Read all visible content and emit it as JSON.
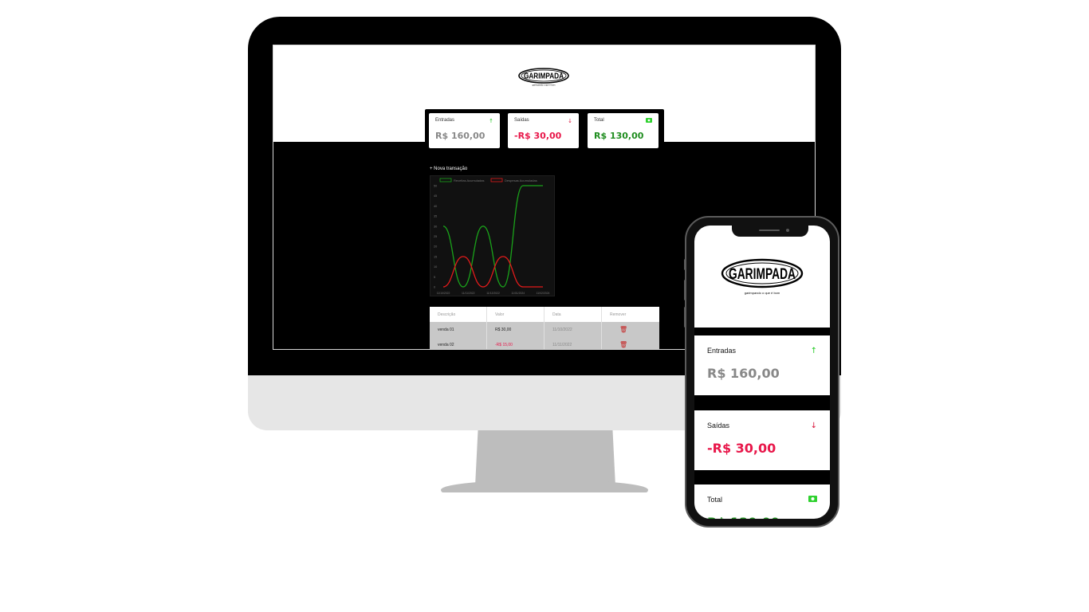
{
  "app": {
    "brand": "GARIMPADA",
    "tagline": "garimpando o que é bom"
  },
  "colors": {
    "income": "#888888",
    "expense": "#e8174a",
    "total": "#1f8d1f",
    "arrow_up": "#22c922",
    "arrow_down": "#d8143a",
    "money_icon": "#2fd12f"
  },
  "summary": {
    "income": {
      "label": "Entradas",
      "value": "R$ 160,00",
      "icon": "arrow-up-icon"
    },
    "expense": {
      "label": "Saídas",
      "value": "-R$ 30,00",
      "icon": "arrow-down-icon"
    },
    "total": {
      "label": "Total",
      "value": "R$ 130,00",
      "icon": "money-icon"
    }
  },
  "new_transaction_label": "+ Nova transação",
  "chart_data": {
    "type": "line",
    "legend": [
      "Receitas Acumuladas",
      "Despesas Acumuladas"
    ],
    "legend_placement": "top",
    "x": [
      "11/10/2022",
      "11/11/2022",
      "11/12/2022",
      "11/01/2024",
      "11/02/2024"
    ],
    "ylim": [
      0,
      50
    ],
    "yticks": [
      0,
      5,
      10,
      15,
      20,
      25,
      30,
      35,
      40,
      45,
      50
    ],
    "grid": false,
    "series": [
      {
        "name": "Receitas Acumuladas",
        "color": "#1aa31a",
        "values": [
          30,
          0,
          30,
          0,
          50,
          50
        ]
      },
      {
        "name": "Despesas Acumuladas",
        "color": "#e21b1b",
        "values": [
          0,
          15,
          0,
          15,
          0,
          0
        ]
      }
    ]
  },
  "table": {
    "headers": [
      "Descrição",
      "Valor",
      "Data",
      "Remover"
    ],
    "rows": [
      {
        "description": "venda 01",
        "value": "R$ 30,00",
        "date": "11/10/2022"
      },
      {
        "description": "venda 02",
        "value": "-R$ 15,00",
        "date": "11/11/2022"
      }
    ]
  }
}
